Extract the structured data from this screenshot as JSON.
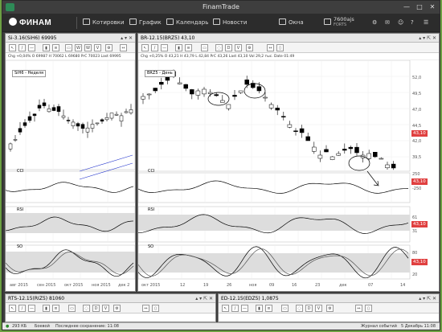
{
  "window": {
    "title": "FinamTrade",
    "minimize": "—",
    "maximize": "□",
    "close": "✕"
  },
  "toolbar": {
    "logo": "ФИНАМ",
    "items": [
      {
        "label": "Котировки"
      },
      {
        "label": "График"
      },
      {
        "label": "Календарь"
      },
      {
        "label": "Новости"
      },
      {
        "label": "Окна"
      }
    ],
    "account": {
      "name": "7600ajs",
      "sub": "FORTS"
    }
  },
  "panels": {
    "si": {
      "title": "Si-3.16(SiH6) 69995",
      "quote": "Chg +0,04%  O 69987  H 70062  L 69680  PrC 70023  Last 69995",
      "series_label": "SiH6 - Неделя",
      "indicators": [
        "CCI",
        "RSI",
        "SO"
      ],
      "xticks": [
        "авг 2015",
        "сен 2015",
        "окт 2015",
        "ноя 2015",
        "дек 2"
      ]
    },
    "br": {
      "title": "BR-12.15(BRZ5) 43,10",
      "quote": "Chg +0,25%  O 43,21  H 43,79  L 42,84  PrC 43,26  Last 43,10  Vol 29,2 тыс.  Date 01:49",
      "series_label": "BRZ5 - День",
      "yticks": [
        "52,0",
        "49,5",
        "47,0",
        "44,5",
        "42,0",
        "39,5"
      ],
      "price": "43,10",
      "indicators": [
        "CCI",
        "RSI",
        "SO"
      ],
      "cci_ticks": [
        "250",
        "0",
        "-250"
      ],
      "rsi_ticks": [
        "61",
        "31"
      ],
      "so_ticks": [
        "80",
        "20"
      ],
      "xticks": [
        "окт 2015",
        "12",
        "19",
        "26",
        "ноя",
        "09",
        "16",
        "23",
        "дек",
        "07",
        "14"
      ]
    },
    "rts": {
      "title": "RTS-12.15(RIZ5) 81060"
    },
    "ed": {
      "title": "ED-12.15(EDZ5) 1,0875"
    }
  },
  "status": {
    "left": "293 КБ",
    "server": "Боевой",
    "saved": "Последнее сохранение: 11:08",
    "journal": "Журнал событий",
    "date": "5 Декабрь 11:08"
  },
  "colors": {
    "accent": "#e04040",
    "brand": "#2e8b57"
  }
}
